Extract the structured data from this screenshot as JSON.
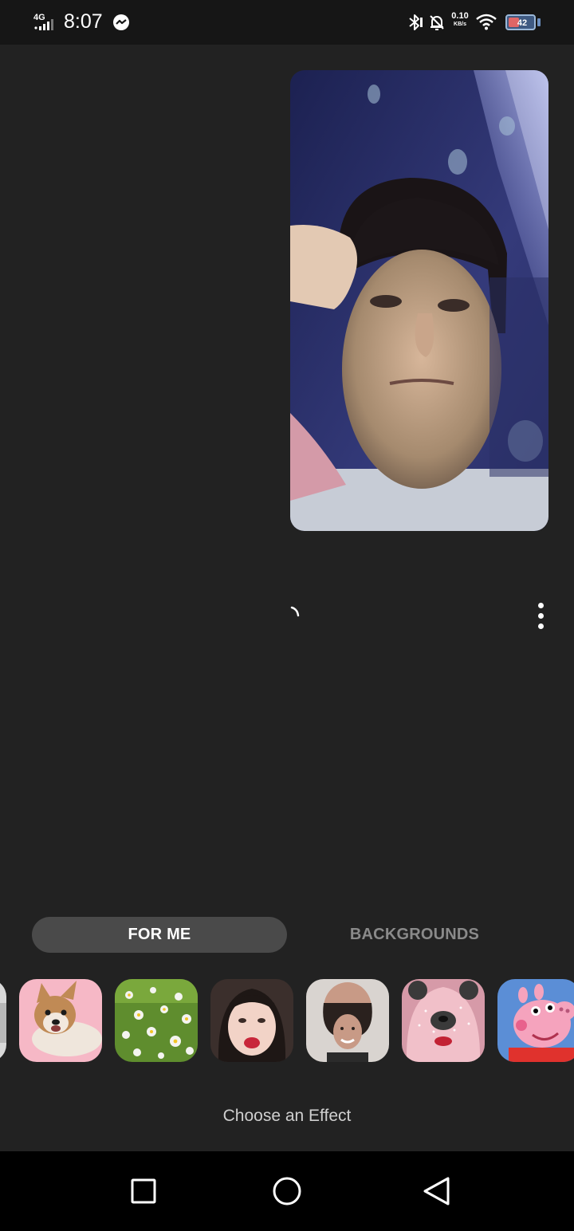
{
  "status_bar": {
    "network": "4G",
    "time": "8:07",
    "net_speed_value": "0.10",
    "net_speed_unit": "KB/s",
    "battery": "42",
    "icons": [
      "signal-icon",
      "messenger-icon",
      "bluetooth-icon",
      "bell-off-icon",
      "wifi-icon",
      "battery-icon"
    ]
  },
  "tabs": [
    {
      "label": "FOR ME",
      "selected": true
    },
    {
      "label": "BACKGROUNDS",
      "selected": false
    }
  ],
  "effects_label": "Choose an Effect",
  "colors": {
    "background": "#222222",
    "tab_selected_bg": "#4a4a4a",
    "tab_unselected_text": "#8a8a8a",
    "status_bar_bg": "#161616",
    "nav_bar_bg": "#000000"
  },
  "nav_bar": {
    "icons": [
      "recents-square-icon",
      "home-circle-icon",
      "back-triangle-icon"
    ]
  }
}
